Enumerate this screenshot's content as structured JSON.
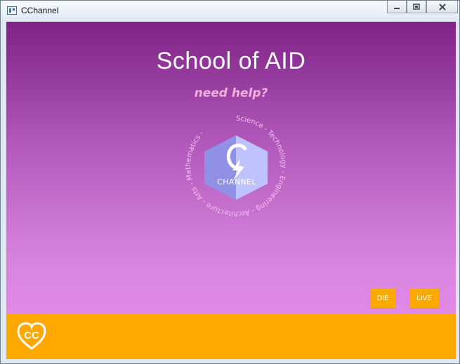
{
  "window": {
    "title": "CChannel",
    "controls": [
      "minimize-icon",
      "maximize-icon",
      "close-icon"
    ]
  },
  "main": {
    "heading": "School of AID",
    "subheading": "need help?",
    "logo": {
      "circle_text": "Science - Technology - Engineering - Architecture - Arts - Mathematics -",
      "channel_label": "CHANNEL",
      "icon_names": [
        "hexagon-c-icon",
        "lightning-bolt-icon"
      ]
    },
    "buttons": {
      "die": "DIE",
      "live": "LIVE"
    }
  },
  "footer": {
    "logo_text": "CC",
    "logo_icon": "heart-cc-icon"
  },
  "colors": {
    "accent_orange": "#ffa800",
    "background_top": "#7f2386",
    "background_bottom": "#e88ded",
    "subheading_pink": "#f2b0df"
  }
}
